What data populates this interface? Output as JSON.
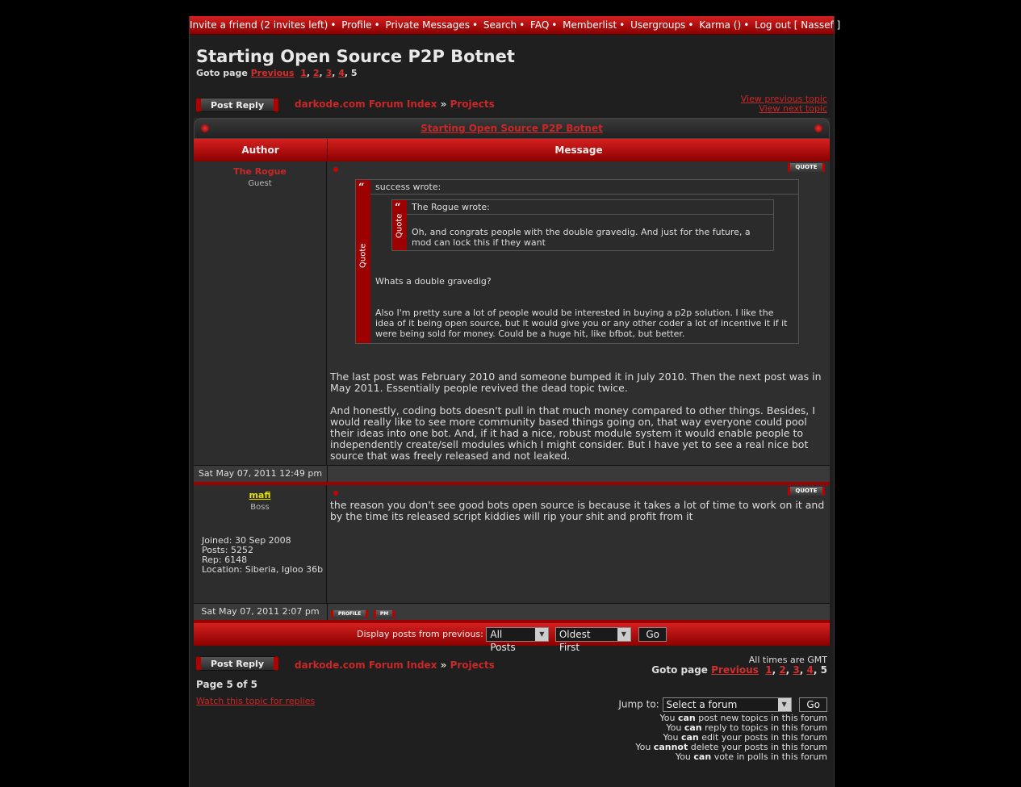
{
  "nav": {
    "items": [
      "Invite a friend (2 invites left)",
      "Profile",
      "Private Messages",
      "Search",
      "FAQ",
      "Memberlist",
      "Usergroups",
      "Karma ()",
      "Log out [ Nassef ]"
    ],
    "separator": "•"
  },
  "topic": {
    "title": "Starting Open Source P2P Botnet",
    "goto_label": "Goto page",
    "previous": "Previous",
    "pages": [
      "1",
      "2",
      "3",
      "4"
    ],
    "current_page": "5"
  },
  "actions": {
    "post_reply": "Post Reply",
    "view_previous": "View previous topic",
    "view_next": "View next topic"
  },
  "breadcrumb": {
    "index": "darkode.com Forum Index",
    "sep": "»",
    "forum": "Projects"
  },
  "table": {
    "author_col": "Author",
    "message_col": "Message"
  },
  "posts": [
    {
      "author": "The Rogue",
      "rank": "Guest",
      "date": "Sat May 07, 2011 12:49 pm",
      "quote_btn": "QUOTE",
      "outer_quote_header": "success wrote:",
      "inner_quote_header": "The Rogue wrote:",
      "inner_quote_text": "Oh, and congrats people with the double gravedig. And just for the future, a mod can lock this if they want",
      "outer_quote_p1": "Whats a double gravedig?",
      "outer_quote_p2": "Also I'm pretty sure a lot of people would be interested in buying a p2p solution. I like the idea of it being open source, but it would give you or any other coder a lot of incentive it if it were being sold for money. Could be a huge hit, like bfbot, but better.",
      "quote_label": "Quote",
      "quote_mark": "“",
      "body_p1": "The last post was February 2010 and someone bumped it in July 2010. Then the next post was in May 2011. Essentially people revived the dead topic twice.",
      "body_p2": "And honestly, coding bots doesn't pull in that much money compared to other things. Besides, I would really like to see more community based things going on, that way everyone could pool their ideas into one bot. And, if it had a nice, robust module system it would enable people to independently create/sell modules which I might consider. But I have yet to see a real nice bot source that was freely released and not leaked."
    },
    {
      "author": "mafi",
      "rank": "Boss",
      "joined": "Joined: 30 Sep 2008",
      "posts": "Posts: 5252",
      "rep": "Rep: 6148",
      "location": "Location: Siberia, Igloo 36b",
      "date": "Sat May 07, 2011 2:07 pm",
      "quote_btn": "QUOTE",
      "profile_btn": "PROFILE",
      "pm_btn": "PM",
      "body": "the reason you don't see good bots open source is because it takes a lot of time to work on it and by the time its released script kiddies will rip your shit and profit from it"
    }
  ],
  "display": {
    "label": "Display posts from previous:",
    "posts_select": "All Posts",
    "order_select": "Oldest First",
    "go": "Go"
  },
  "footer": {
    "timezone": "All times are GMT",
    "page_of": "Page 5 of 5",
    "watch": "Watch this topic for replies",
    "jump_label": "Jump to:",
    "jump_select": "Select a forum",
    "jump_go": "Go",
    "perms": [
      {
        "pre": "You",
        "bold": "can",
        "post": "post new topics in this forum"
      },
      {
        "pre": "You",
        "bold": "can",
        "post": "reply to topics in this forum"
      },
      {
        "pre": "You",
        "bold": "can",
        "post": "edit your posts in this forum"
      },
      {
        "pre": "You",
        "bold": "cannot",
        "post": "delete your posts in this forum"
      },
      {
        "pre": "You",
        "bold": "can",
        "post": "vote in polls in this forum"
      }
    ]
  },
  "colors": {
    "accent": "#c82828",
    "username_boss": "#e8e000"
  }
}
